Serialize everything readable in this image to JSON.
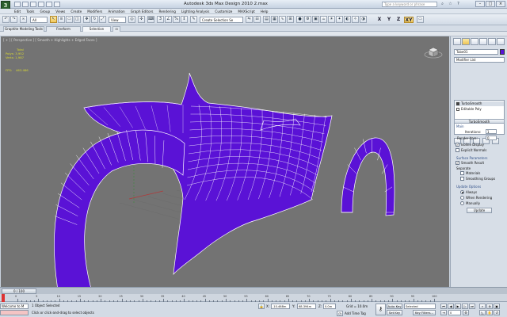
{
  "window": {
    "title": "Autodesk 3ds Max Design 2010     2.max",
    "search_placeholder": "Type a keyword or phrase",
    "logo_glyph": "3"
  },
  "menu": [
    "Edit",
    "Tools",
    "Group",
    "Views",
    "Create",
    "Modifiers",
    "Animation",
    "Graph Editors",
    "Rendering",
    "Lighting Analysis",
    "Customize",
    "MAXScript",
    "Help"
  ],
  "toolbar": {
    "selection_filter": "All",
    "ref_coord": "View",
    "named_selection": "Create Selection Se",
    "axis_x": "X",
    "axis_y": "Y",
    "axis_z": "Z",
    "axis_xy": "XY"
  },
  "ribbon": {
    "tabs": [
      "Graphite Modeling Tools",
      "Freeform",
      "Selection"
    ]
  },
  "viewport": {
    "label": "[ + ] [ Perspective ] [ Smooth + Highlights + Edged Faces ]",
    "stats": {
      "header": "Total",
      "polys_label": "Polys:",
      "polys_value": "3,952",
      "verts_label": "Verts:",
      "verts_value": "1,987"
    },
    "fps_label": "FPS:",
    "fps_value": "463.486",
    "model_color": "#5a12d6",
    "wire_color": "#ffffff",
    "bg_color": "#737373"
  },
  "command_panel": {
    "object_name": "Tube01",
    "modifier_list": "Modifier List",
    "stack": [
      "TurboSmooth",
      "Editable Poly"
    ],
    "rollout_title": "TurboSmooth",
    "main_group": "Main",
    "iterations_label": "Iterations:",
    "iterations_value": "1",
    "render_iters_label": "Render Iters:",
    "render_iters_value": "0",
    "isoline_label": "Isoline Display",
    "isoline_checked": true,
    "explicit_normals_label": "Explicit Normals",
    "explicit_normals_checked": false,
    "surface_group": "Surface Parameters",
    "smooth_result_label": "Smooth Result",
    "smooth_result_checked": true,
    "separate_label": "Separate",
    "materials_label": "Materials",
    "smoothing_groups_label": "Smoothing Groups",
    "update_group": "Update Options",
    "always_label": "Always",
    "when_rendering_label": "When Rendering",
    "manually_label": "Manually",
    "update_selected": "Always",
    "update_button": "Update"
  },
  "timeline": {
    "slider_label": "0 / 100",
    "ticks": [
      "0",
      "5",
      "10",
      "15",
      "20",
      "25",
      "30",
      "35",
      "40",
      "45",
      "50",
      "55",
      "60",
      "65",
      "70",
      "75",
      "80",
      "85",
      "90",
      "95",
      "100"
    ]
  },
  "status": {
    "maxscript": "Welcome to M",
    "selection": "1 Object Selected",
    "prompt": "Click or click-and-drag to select objects",
    "x_label": "X:",
    "x_value": "-10.468m",
    "y_label": "Y:",
    "y_value": "68.394m",
    "z_label": "Z:",
    "z_value": "0.0m",
    "grid": "Grid = 10.0m",
    "add_time_tag": "Add Time Tag",
    "auto_key": "Auto Key",
    "set_key": "Set Key",
    "selected_dropdown": "Selected",
    "key_filters": "Key Filters...",
    "frame": "0"
  }
}
